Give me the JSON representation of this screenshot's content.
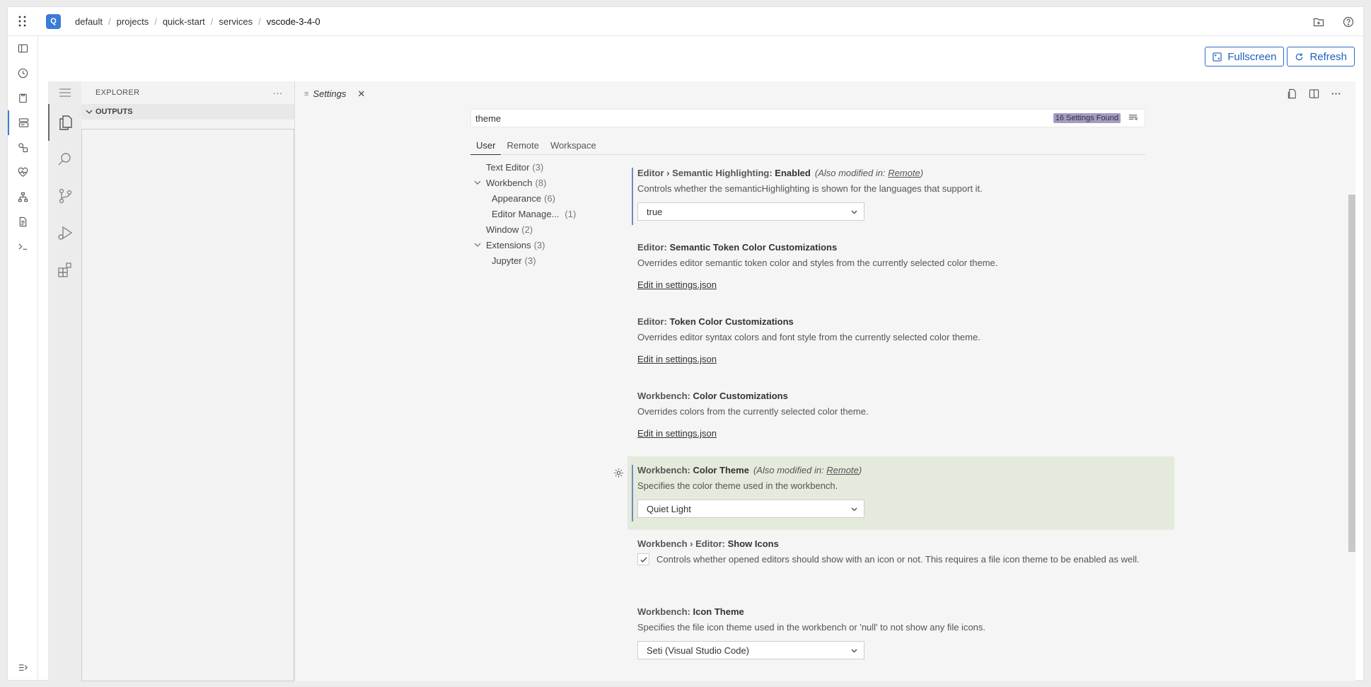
{
  "topbar": {
    "project_badge": "Q",
    "breadcrumb": [
      "default",
      "projects",
      "quick-start",
      "services"
    ],
    "breadcrumb_separator": "/",
    "current": "vscode-3-4-0"
  },
  "actions": {
    "fullscreen_label": "Fullscreen",
    "refresh_label": "Refresh"
  },
  "sidebar": {
    "title": "EXPLORER",
    "more": "···",
    "section": "OUTPUTS"
  },
  "editor": {
    "tab_label": "Settings",
    "tab_icon": "≡",
    "tab_close": "✕"
  },
  "settings": {
    "search_value": "theme",
    "found_badge": "16 Settings Found",
    "scopes": [
      "User",
      "Remote",
      "Workspace"
    ],
    "active_scope": "User",
    "toc": [
      {
        "label": "Text Editor",
        "count": "(3)"
      },
      {
        "label": "Workbench",
        "count": "(8)"
      },
      {
        "label": "Appearance",
        "count": "(6)"
      },
      {
        "label": "Editor Manage...",
        "count": "(1)"
      },
      {
        "label": "Window",
        "count": "(2)"
      },
      {
        "label": "Extensions",
        "count": "(3)"
      },
      {
        "label": "Jupyter",
        "count": "(3)"
      }
    ],
    "also_modified_prefix": "(Also modified in: ",
    "also_modified_link": "Remote",
    "also_modified_suffix": ")",
    "edit_in_json": "Edit in settings.json",
    "items": [
      {
        "category": "Editor › Semantic Highlighting: ",
        "name": "Enabled",
        "desc": "Controls whether the semanticHighlighting is shown for the languages that support it.",
        "value": "true"
      },
      {
        "category": "Editor: ",
        "name": "Semantic Token Color Customizations",
        "desc": "Overrides editor semantic token color and styles from the currently selected color theme."
      },
      {
        "category": "Editor: ",
        "name": "Token Color Customizations",
        "desc": "Overrides editor syntax colors and font style from the currently selected color theme."
      },
      {
        "category": "Workbench: ",
        "name": "Color Customizations",
        "desc": "Overrides colors from the currently selected color theme."
      },
      {
        "category": "Workbench: ",
        "name": "Color Theme",
        "desc": "Specifies the color theme used in the workbench.",
        "value": "Quiet Light"
      },
      {
        "category": "Workbench › Editor: ",
        "name": "Show Icons",
        "desc": "Controls whether opened editors should show with an icon or not. This requires a file icon theme to be enabled as well."
      },
      {
        "category": "Workbench: ",
        "name": "Icon Theme",
        "desc": "Specifies the file icon theme used in the workbench or 'null' to not show any file icons.",
        "value": "Seti (Visual Studio Code)"
      }
    ]
  },
  "colors": {
    "accent": "#3b7bd6",
    "highlight_row": "#e4eadc",
    "found_badge": "#a59ac4"
  }
}
